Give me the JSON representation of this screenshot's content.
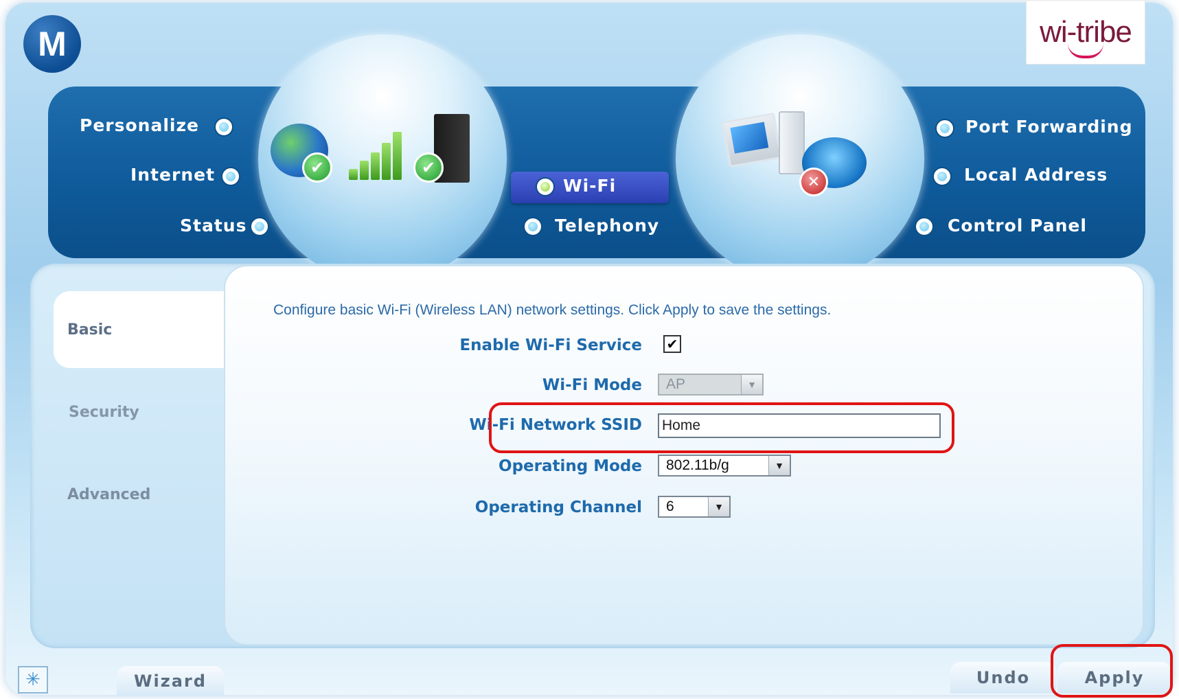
{
  "branding": {
    "left_logo_glyph": "M",
    "right_logo_text": "wi-tribe"
  },
  "nav": {
    "left_items": [
      "Personalize",
      "Internet",
      "Status"
    ],
    "center_items": [
      "Wi-Fi",
      "Telephony"
    ],
    "active_item": "Wi-Fi",
    "right_items": [
      "Port Forwarding",
      "Local Address",
      "Control Panel"
    ]
  },
  "sidebar": {
    "items": [
      {
        "label": "Basic",
        "active": true
      },
      {
        "label": "Security",
        "active": false
      },
      {
        "label": "Advanced",
        "active": false
      }
    ]
  },
  "form": {
    "description": "Configure basic Wi-Fi (Wireless LAN) network settings. Click Apply to save the settings.",
    "enable_label": "Enable Wi-Fi Service",
    "enable_checked": true,
    "check_glyph": "✔",
    "mode_label": "Wi-Fi Mode",
    "mode_value": "AP",
    "ssid_label": "Wi-Fi Network SSID",
    "ssid_value": "Home",
    "opmode_label": "Operating Mode",
    "opmode_value": "802.11b/g",
    "channel_label": "Operating Channel",
    "channel_value": "6"
  },
  "footer": {
    "wizard_label": "Wizard",
    "undo_label": "Undo",
    "apply_label": "Apply"
  },
  "colors": {
    "accent_blue": "#1e6aac",
    "nav_blue": "#0f5b9b",
    "highlight_red": "#e01414",
    "active_tab": "#2b3fb2"
  },
  "icons": {
    "dropdown": "▼",
    "spinner": "✳"
  }
}
